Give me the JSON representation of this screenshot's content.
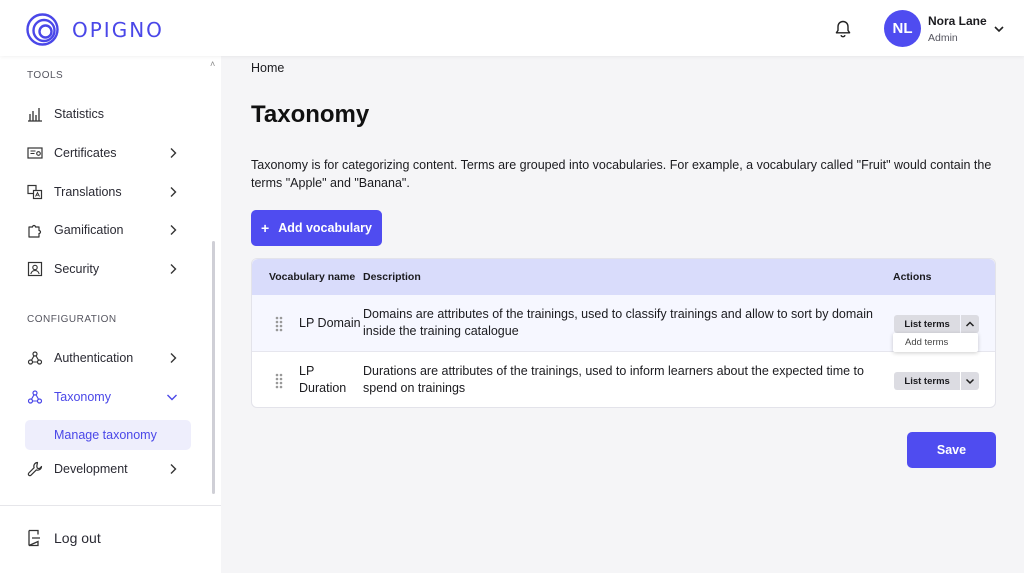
{
  "app": {
    "logo_text": "OPIGNO",
    "brand_color": "#4f4cf0"
  },
  "header": {
    "bell_icon": "bell-icon",
    "user": {
      "initials": "NL",
      "name": "Nora Lane",
      "role": "Admin"
    }
  },
  "sidebar": {
    "tools_label": "TOOLS",
    "tools": [
      {
        "label": "Statistics",
        "icon": "chart-icon"
      },
      {
        "label": "Certificates",
        "icon": "certificate-icon"
      },
      {
        "label": "Translations",
        "icon": "translate-icon"
      },
      {
        "label": "Gamification",
        "icon": "puzzle-icon"
      },
      {
        "label": "Security",
        "icon": "security-icon"
      }
    ],
    "config_label": "CONFIGURATION",
    "config": [
      {
        "label": "Authentication",
        "icon": "nodes-icon"
      },
      {
        "label": "Taxonomy",
        "icon": "nodes-icon"
      },
      {
        "label": "Development",
        "icon": "wrench-icon"
      }
    ],
    "active_sub": "Manage taxonomy",
    "logout": "Log out"
  },
  "main": {
    "breadcrumb": "Home",
    "title": "Taxonomy",
    "description": "Taxonomy is for categorizing content. Terms are grouped into vocabularies. For example, a vocabulary called \"Fruit\" would contain the terms \"Apple\" and \"Banana\".",
    "add_button": "Add vocabulary",
    "add_button_prefix": "+",
    "table": {
      "headers": {
        "name": "Vocabulary name",
        "description": "Description",
        "actions": "Actions"
      },
      "rows": [
        {
          "name": "LP Domain",
          "description": "Domains are attributes of the trainings, used to classify trainings and allow to sort by domain inside the training catalogue",
          "action": "List terms"
        },
        {
          "name": "LP Duration",
          "description": "Durations are attributes of the trainings, used to inform learners about the expected time to spend on trainings",
          "action": "List terms"
        }
      ],
      "dropdown_item": "Add terms"
    },
    "save_button": "Save"
  }
}
